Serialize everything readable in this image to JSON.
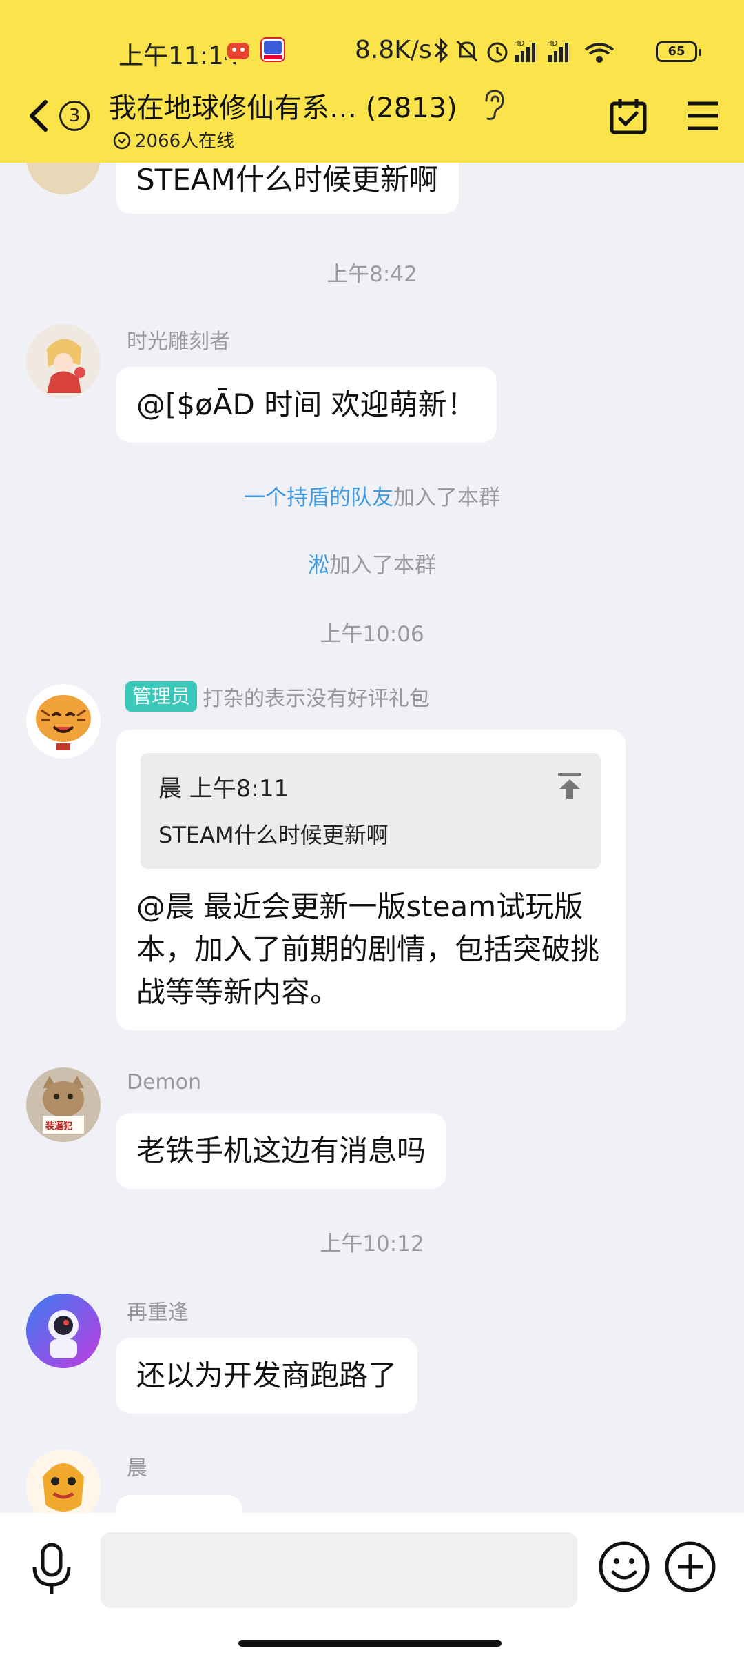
{
  "status_bar": {
    "time": "上午11:14",
    "network_speed": "8.8K/s",
    "battery": "65",
    "icon_names": [
      "app-icon-red",
      "app-icon-blue",
      "bluetooth-icon",
      "mute-icon",
      "alarm-icon",
      "hd-signal-icon",
      "hd-signal-icon",
      "wifi-icon",
      "battery-icon"
    ]
  },
  "header": {
    "back_count": "3",
    "title": "我在地球修仙有系…  (2813)",
    "online": "2066人在线",
    "bg_color": "#fbe34b"
  },
  "chat": {
    "first_bubble": "STEAM什么时候更新啊",
    "time1": "上午8:42",
    "msg1": {
      "name": "时光雕刻者",
      "text": "@[$øĀD 时间 欢迎萌新！"
    },
    "sys1": {
      "link": "一个持盾的队友",
      "text": "加入了本群"
    },
    "sys2": {
      "link": "淞",
      "text": "加入了本群"
    },
    "time2": "上午10:06",
    "msg2": {
      "badge": "管理员",
      "name": "打杂的表示没有好评礼包",
      "quote_head": "晨 上午8:11",
      "quote_text": "STEAM什么时候更新啊",
      "text": "@晨 最近会更新一版steam试玩版本，加入了前期的剧情，包括突破挑战等等新内容。"
    },
    "msg3": {
      "name": "Demon",
      "text": "老铁手机这边有消息吗",
      "avatar_sign": "装逼犯"
    },
    "time3": "上午10:12",
    "msg4": {
      "name": "再重逢",
      "text": "还以为开发商跑路了"
    },
    "msg5": {
      "name": "晨"
    }
  },
  "input": {
    "placeholder": ""
  },
  "colors": {
    "link": "#3d9ae3",
    "admin_badge": "#3cc7bb",
    "chat_bg": "#f0f1f6"
  }
}
